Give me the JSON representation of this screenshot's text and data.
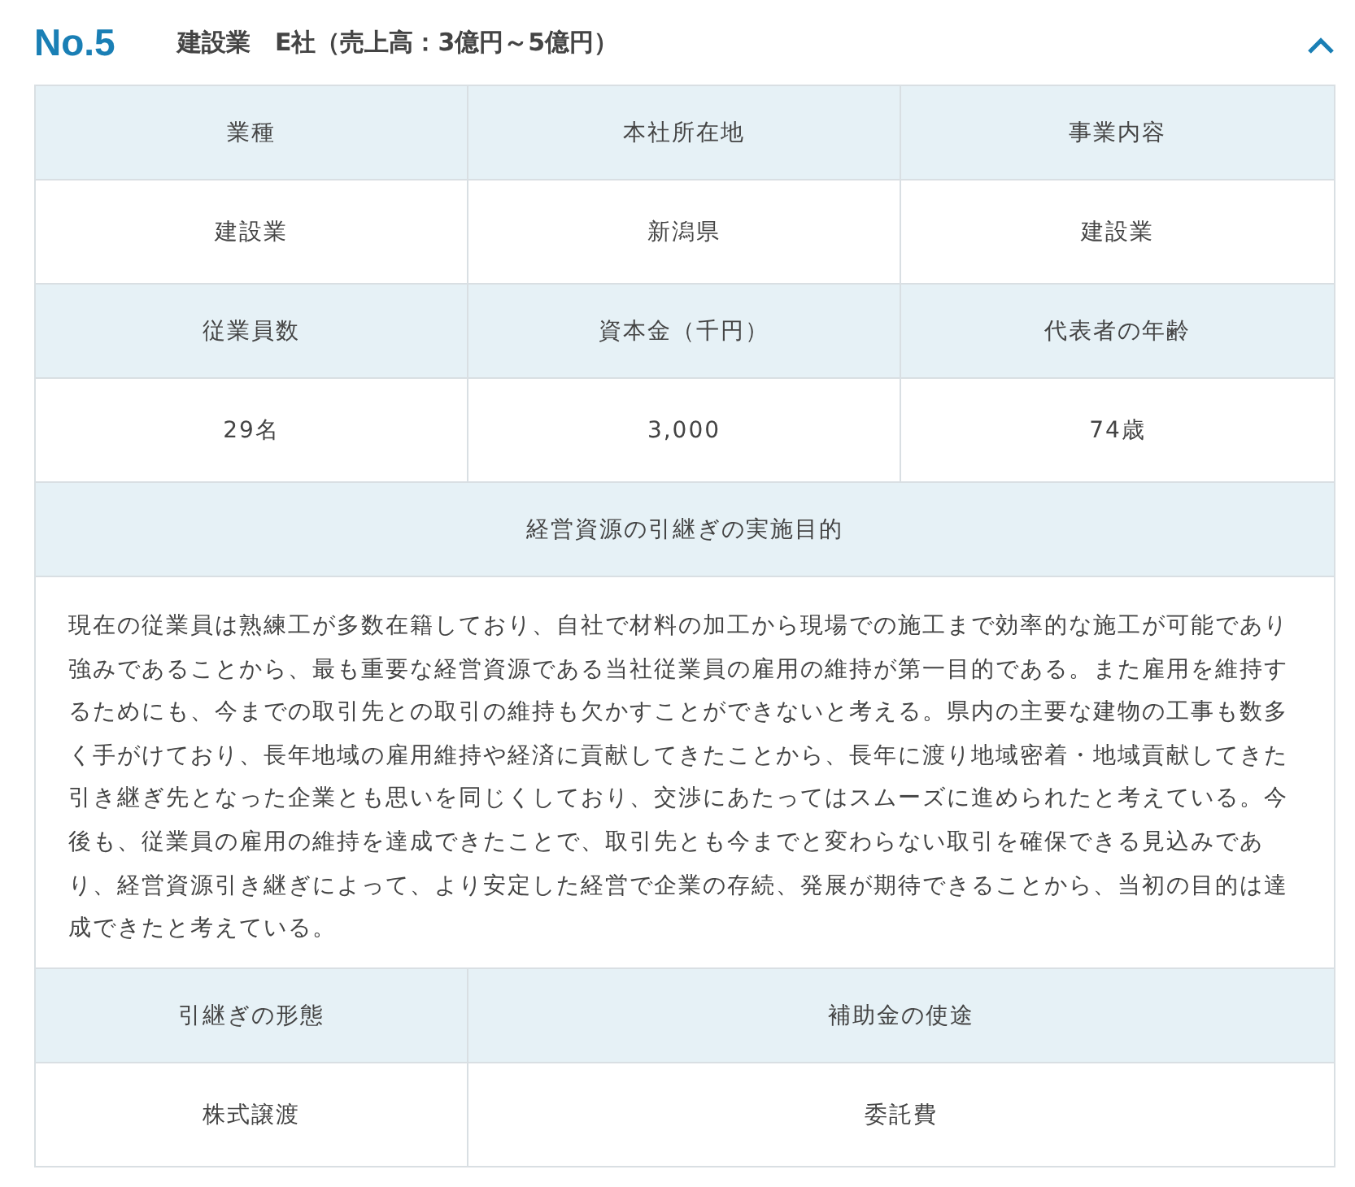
{
  "header": {
    "number": "No.5",
    "title": "建設業　E社（売上高：3億円～5億円）",
    "expanded": true
  },
  "table": {
    "rows": [
      {
        "kind": "head",
        "cells": [
          "業種",
          "本社所在地",
          "事業内容"
        ]
      },
      {
        "kind": "data",
        "cells": [
          "建設業",
          "新潟県",
          "建設業"
        ]
      },
      {
        "kind": "head",
        "cells": [
          "従業員数",
          "資本金（千円）",
          "代表者の年齢"
        ]
      },
      {
        "kind": "data",
        "cells": [
          "29名",
          "3,000",
          "74歳"
        ]
      },
      {
        "kind": "head",
        "cells": [
          "経営資源の引継ぎの実施目的"
        ]
      },
      {
        "kind": "text",
        "cells": [
          "現在の従業員は熟練工が多数在籍しており、自社で材料の加工から現場での施工まで効率的な施工が可能であり強みであることから、最も重要な経営資源である当社従業員の雇用の維持が第一目的である。また雇用を維持するためにも、今までの取引先との取引の維持も欠かすことができないと考える。県内の主要な建物の工事も数多く手がけており、長年地域の雇用維持や経済に貢献してきたことから、長年に渡り地域密着・地域貢献してきた引き継ぎ先となった企業とも思いを同じくしており、交渉にあたってはスムーズに進められたと考えている。今後も、従業員の雇用の維持を達成できたことで、取引先とも今までと変わらない取引を確保できる見込みであり、経営資源引き継ぎによって、より安定した経営で企業の存続、発展が期待できることから、当初の目的は達成できたと考えている。"
        ]
      },
      {
        "kind": "head",
        "cells": [
          "引継ぎの形態",
          "補助金の使途"
        ]
      },
      {
        "kind": "data",
        "cells": [
          "株式譲渡",
          "委託費"
        ]
      }
    ]
  }
}
